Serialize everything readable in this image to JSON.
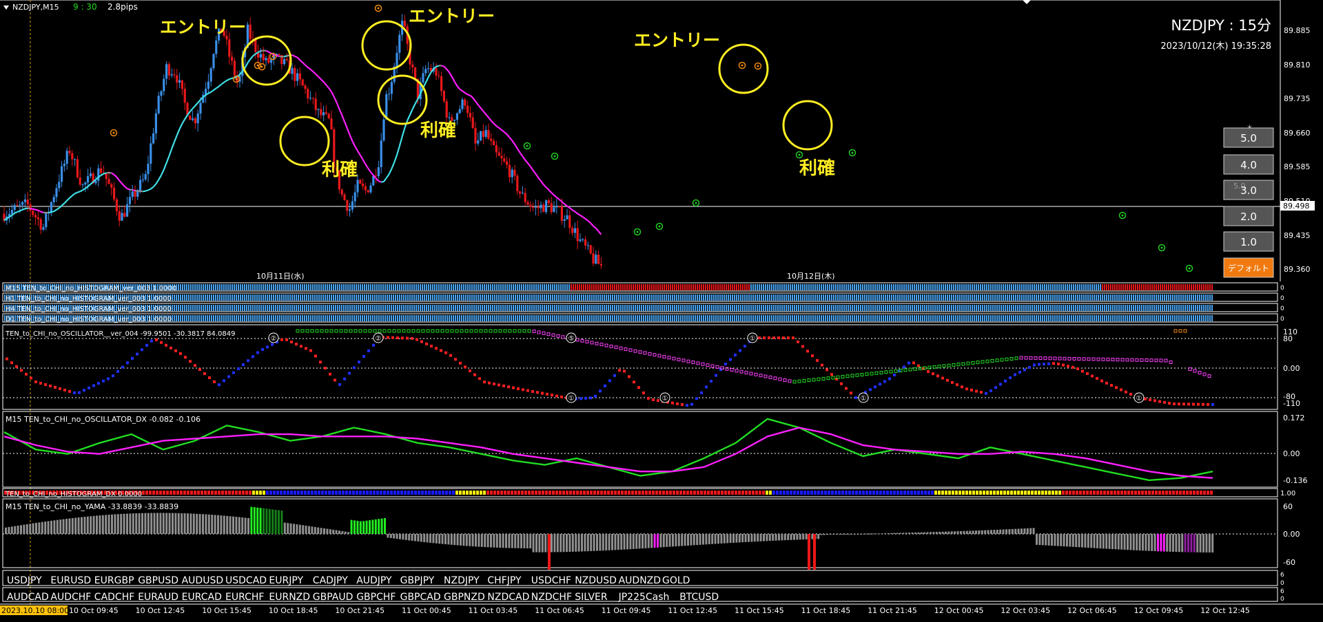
{
  "window": {
    "symbol_period": "NZDJPY,M15",
    "countdown": "9 : 30",
    "spread": "2.8pips"
  },
  "overlay": {
    "title": "NZDJPY : 15分",
    "datetime": "2023/10/12(木) 19:35:28"
  },
  "annotations": {
    "entries": [
      "エントリー",
      "エントリー",
      "エントリー"
    ],
    "profits": [
      "利確",
      "利確",
      "利確"
    ]
  },
  "price_axis": [
    "89.885",
    "89.810",
    "89.735",
    "89.660",
    "89.585",
    "89.510",
    "89.435",
    "89.360"
  ],
  "current_price": "89.498",
  "date_labels": [
    "10月11日(水)",
    "10月12日(木)"
  ],
  "size_buttons": {
    "star": "*",
    "faded": "5.0",
    "items": [
      "5.0",
      "4.0",
      "3.0",
      "2.0",
      "1.0"
    ],
    "default_label": "デフォルト"
  },
  "histogram_rows": [
    "M15 TEN_to_CHI_no_HISTOGRAM_ver_003 1.0000",
    "H1 TEN_to_CHI_no_HISTOGRAM_ver_003 1.0000",
    "H4 TEN_to_CHI_no_HISTOGRAM_ver_003 1.0000",
    "D1 TEN_to_CHI_no_HISTOGRAM_ver_003 1.0000"
  ],
  "histogram_row_scale": [
    "0",
    "0",
    "0",
    "0"
  ],
  "oscillator": {
    "label": "TEN_to_CHI_no_OSCILLATOR__ver_004 -99.9501 -30.3817 84.0849",
    "axis": [
      "110",
      "80",
      "0.00",
      "-80",
      "-110"
    ],
    "markers": [
      "②",
      "②",
      "⑤",
      "①",
      "①",
      "①",
      "①",
      "①",
      "①"
    ]
  },
  "oscillator_dx": {
    "label": "M15 TEN_to_CHI_no_OSCILLATOR_DX -0.082 -0.106",
    "axis": [
      "0.172",
      "0.00",
      "-0.136"
    ]
  },
  "histogram_dx": {
    "label": "TEN_to_CHI_no_HISTOGRAM_DX 0.0000",
    "axis": "1.00"
  },
  "yama": {
    "label": "M15 TEN_to_CHI_no_YAMA -33.8839 -33.8839",
    "axis": [
      "60",
      "0.00",
      "-60"
    ]
  },
  "symbols_row1": [
    "USDJPY",
    "EURUSD",
    "EURGBP",
    "GBPUSD",
    "AUDUSD",
    "USDCAD",
    "EURJPY",
    "CADJPY",
    "AUDJPY",
    "GBPJPY",
    "NZDJPY",
    "CHFJPY",
    "USDCHF",
    "NZDUSD",
    "AUDNZD",
    "GOLD"
  ],
  "symbols_row2": [
    "AUDCAD",
    "AUDCHF",
    "CADCHF",
    "EURAUD",
    "EURCAD",
    "EURCHF",
    "EURNZD",
    "GBPAUD",
    "GBPCHF",
    "GBPCAD",
    "GBPNZD",
    "NZDCAD",
    "NZDCHF",
    "SILVER",
    "JP225Cash",
    "BTCUSD"
  ],
  "active_symbol": "NZDJPY",
  "symbol_row_scale": [
    "6",
    "0",
    "6",
    "0"
  ],
  "time_axis": {
    "highlight": "2023.10.10 08:00",
    "labels": [
      "10 Oct 09:45",
      "10 Oct 12:45",
      "10 Oct 15:45",
      "10 Oct 18:45",
      "10 Oct 21:45",
      "11 Oct 00:45",
      "11 Oct 03:45",
      "11 Oct 06:45",
      "11 Oct 09:45",
      "11 Oct 12:45",
      "11 Oct 15:45",
      "11 Oct 18:45",
      "11 Oct 21:45",
      "12 Oct 00:45",
      "12 Oct 03:45",
      "12 Oct 06:45",
      "12 Oct 09:45",
      "12 Oct 12:45"
    ]
  },
  "colors": {
    "bull": "#3a8fe8",
    "bear": "#e8181c",
    "ma_up": "#40e0e8",
    "ma_down": "#ff20ff",
    "ma_flat": "#909090",
    "annotation": "#ffee22",
    "histogram_blue": "#4aa3ee",
    "histogram_red": "#e8181c",
    "osc_green": "#22dd22",
    "osc_magenta": "#ff20ff",
    "yama_green": "#22ee22",
    "active_symbol": "#ffd700",
    "default_button": "#f07a10",
    "grid": "#dddddd"
  },
  "chart_data": [
    {
      "type": "candlestick",
      "title": "NZDJPY : 15分",
      "ylim": [
        89.33,
        89.93
      ],
      "y_ticks": [
        89.885,
        89.81,
        89.735,
        89.66,
        89.585,
        89.51,
        89.435,
        89.36
      ],
      "current_price": 89.498,
      "path_points": [
        [
          0,
          89.48
        ],
        [
          35,
          89.5
        ],
        [
          60,
          89.45
        ],
        [
          82,
          89.55
        ],
        [
          100,
          89.62
        ],
        [
          120,
          89.54
        ],
        [
          150,
          89.58
        ],
        [
          178,
          89.47
        ],
        [
          198,
          89.52
        ],
        [
          216,
          89.56
        ],
        [
          232,
          89.7
        ],
        [
          248,
          89.8
        ],
        [
          262,
          89.79
        ],
        [
          276,
          89.72
        ],
        [
          290,
          89.68
        ],
        [
          312,
          89.78
        ],
        [
          320,
          89.84
        ],
        [
          333,
          89.89
        ],
        [
          345,
          89.82
        ],
        [
          358,
          89.76
        ],
        [
          372,
          89.88
        ],
        [
          385,
          89.84
        ],
        [
          400,
          89.81
        ],
        [
          415,
          89.82
        ],
        [
          435,
          89.8
        ],
        [
          460,
          89.75
        ],
        [
          480,
          89.7
        ],
        [
          498,
          89.68
        ],
        [
          505,
          89.58
        ],
        [
          516,
          89.52
        ],
        [
          528,
          89.49
        ],
        [
          540,
          89.54
        ],
        [
          552,
          89.53
        ],
        [
          562,
          89.55
        ],
        [
          573,
          89.6
        ],
        [
          582,
          89.73
        ],
        [
          590,
          89.76
        ],
        [
          600,
          89.84
        ],
        [
          609,
          89.9
        ],
        [
          618,
          89.83
        ],
        [
          632,
          89.74
        ],
        [
          645,
          89.8
        ],
        [
          660,
          89.79
        ],
        [
          680,
          89.68
        ],
        [
          705,
          89.73
        ],
        [
          720,
          89.63
        ],
        [
          735,
          89.66
        ],
        [
          750,
          89.61
        ],
        [
          770,
          89.58
        ],
        [
          790,
          89.52
        ],
        [
          810,
          89.49
        ],
        [
          830,
          89.5
        ],
        [
          860,
          89.47
        ],
        [
          880,
          89.42
        ],
        [
          900,
          89.38
        ],
        [
          916,
          89.36
        ]
      ],
      "pivot_circles": {
        "orange": 8,
        "green": 10
      }
    },
    {
      "type": "line",
      "title": "TEN_to_CHI_no_OSCILLATOR_DX",
      "ylim": [
        -0.136,
        0.172
      ],
      "series": [
        {
          "name": "",
          "values": [
            0.1,
            0.02,
            0.0,
            0.05,
            0.09,
            0.02,
            0.06,
            0.13,
            0.1,
            0.06,
            0.08,
            0.12,
            0.09,
            0.05,
            0.03,
            0.0,
            -0.03,
            -0.05,
            -0.02,
            -0.06,
            -0.1,
            -0.08,
            -0.02,
            0.05,
            0.16,
            0.12,
            0.05,
            -0.01,
            0.02,
            0.0,
            -0.02,
            0.03,
            0.0,
            -0.03,
            -0.06,
            -0.09,
            -0.12,
            -0.11,
            -0.08
          ]
        },
        {
          "name": "",
          "values": [
            0.08,
            0.04,
            0.01,
            0.0,
            0.03,
            0.06,
            0.07,
            0.08,
            0.09,
            0.09,
            0.08,
            0.08,
            0.08,
            0.07,
            0.05,
            0.03,
            0.0,
            -0.02,
            -0.04,
            -0.06,
            -0.08,
            -0.08,
            -0.06,
            0.0,
            0.08,
            0.12,
            0.09,
            0.04,
            0.02,
            0.01,
            0.0,
            0.0,
            0.01,
            0.0,
            -0.02,
            -0.05,
            -0.08,
            -0.1,
            -0.11
          ]
        }
      ]
    },
    {
      "type": "bar",
      "title": "TEN_to_CHI_no_YAMA",
      "ylim": [
        -60,
        60
      ],
      "value_last": -33.8839
    }
  ]
}
